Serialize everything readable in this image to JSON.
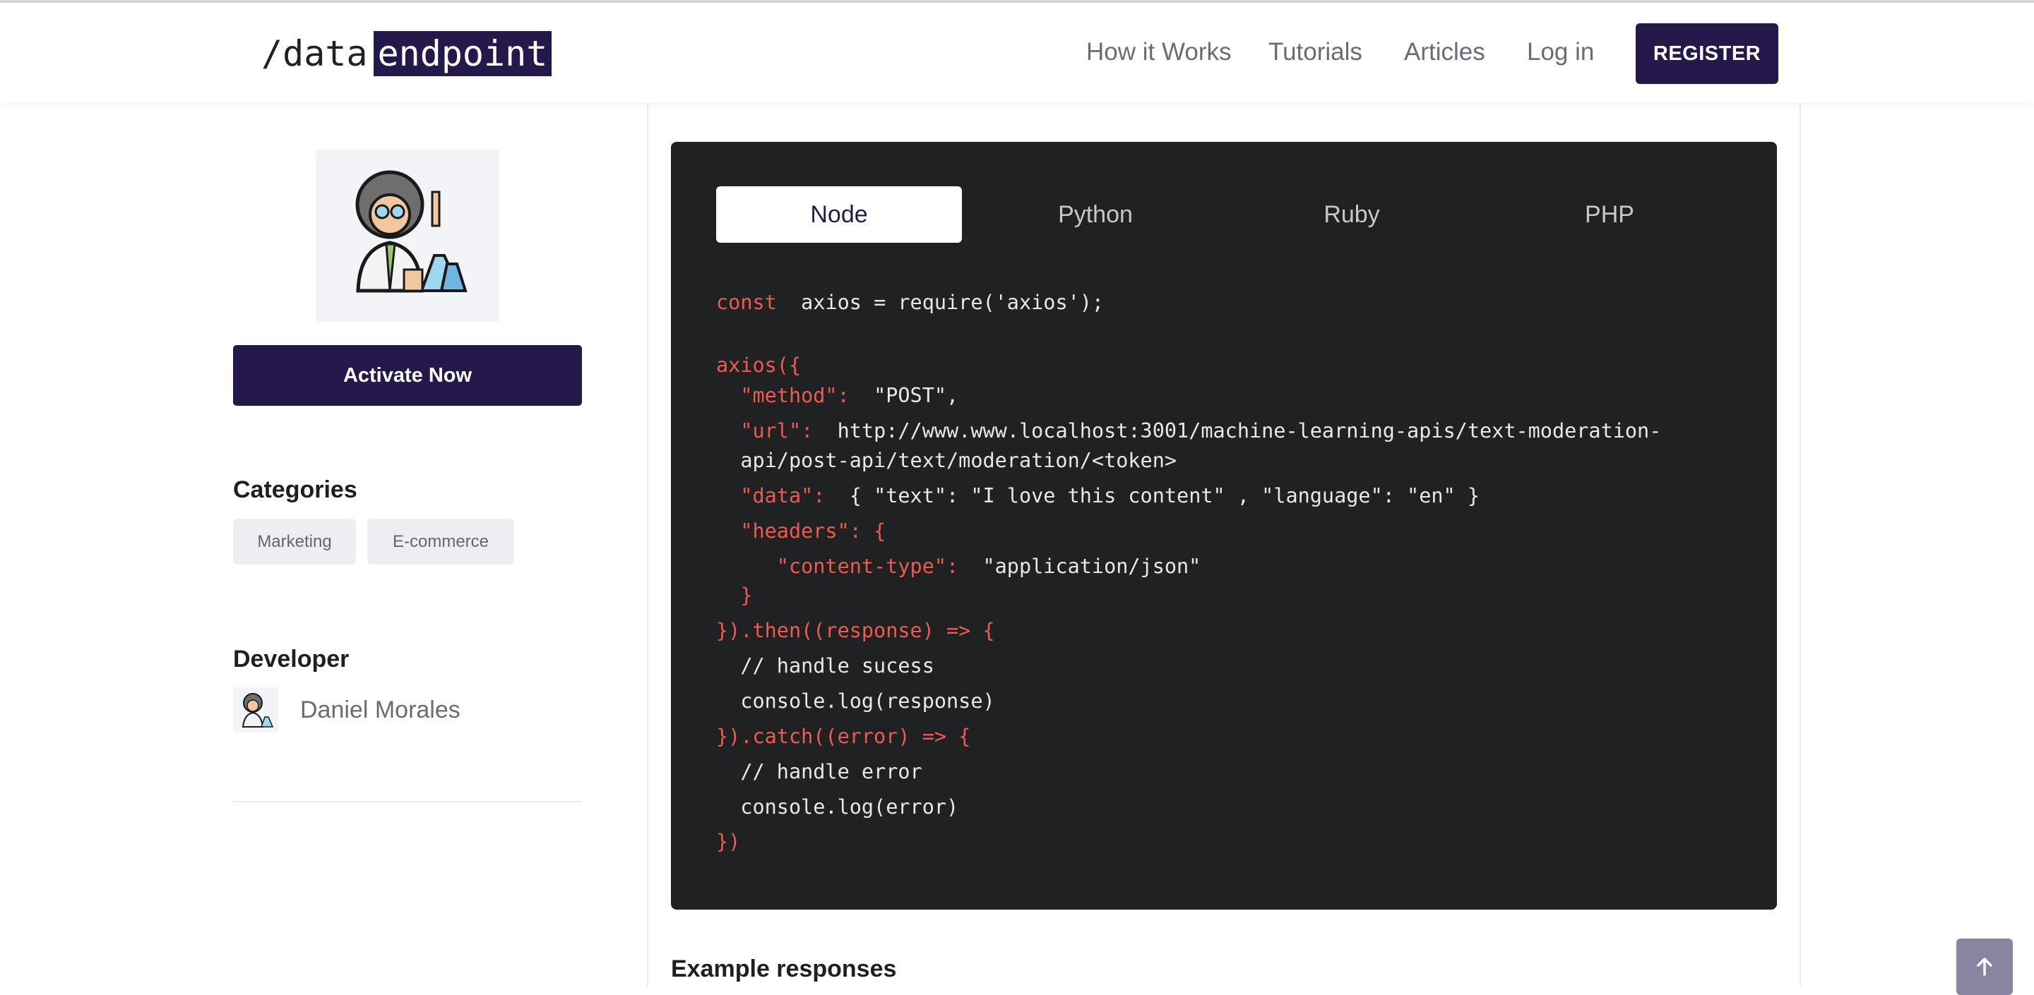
{
  "header": {
    "logo_prefix": "/data",
    "logo_highlight": "endpoint",
    "nav": [
      "How it Works",
      "Tutorials",
      "Articles",
      "Log in"
    ],
    "register_label": "REGISTER"
  },
  "sidebar": {
    "activate_label": "Activate Now",
    "categories_title": "Categories",
    "categories": [
      "Marketing",
      "E-commerce"
    ],
    "developer_title": "Developer",
    "developer_name": "Daniel Morales"
  },
  "code": {
    "tabs": [
      "Node",
      "Python",
      "Ruby",
      "PHP"
    ],
    "active_tab": "Node",
    "lines": [
      {
        "kw": "const",
        "text": "  axios = require('axios');"
      },
      {
        "kw": "axios({",
        "text": ""
      },
      {
        "kw": "  \"method\":",
        "text": "  \"POST\","
      },
      {
        "kw": "  \"url\":",
        "text": "  http://www.www.localhost:3001/machine-learning-apis/text-moderation-"
      },
      {
        "kw": "",
        "text": "  api/post-api/text/moderation/<token>"
      },
      {
        "kw": "  \"data\":",
        "text": "  { \"text\": \"I love this content\" , \"language\": \"en\" }"
      },
      {
        "kw": "  \"headers\": {",
        "text": ""
      },
      {
        "kw": "     \"content-type\":",
        "text": "  \"application/json\""
      },
      {
        "kw": "  }",
        "text": ""
      },
      {
        "kw": "}).then((response) => {",
        "text": ""
      },
      {
        "kw": "",
        "text": "  // handle sucess"
      },
      {
        "kw": "",
        "text": "  console.log(response)"
      },
      {
        "kw": "}).catch((error) => {",
        "text": ""
      },
      {
        "kw": "",
        "text": "  // handle error"
      },
      {
        "kw": "",
        "text": "  console.log(error)"
      },
      {
        "kw": "})",
        "text": ""
      }
    ],
    "colors": {
      "keyword": "#ef5a4e",
      "text": "#e8e8e8",
      "panel": "#202123"
    }
  },
  "main": {
    "example_title": "Example responses"
  },
  "scroll_top_icon": "arrow-up-icon",
  "accent_color": "#25184a"
}
